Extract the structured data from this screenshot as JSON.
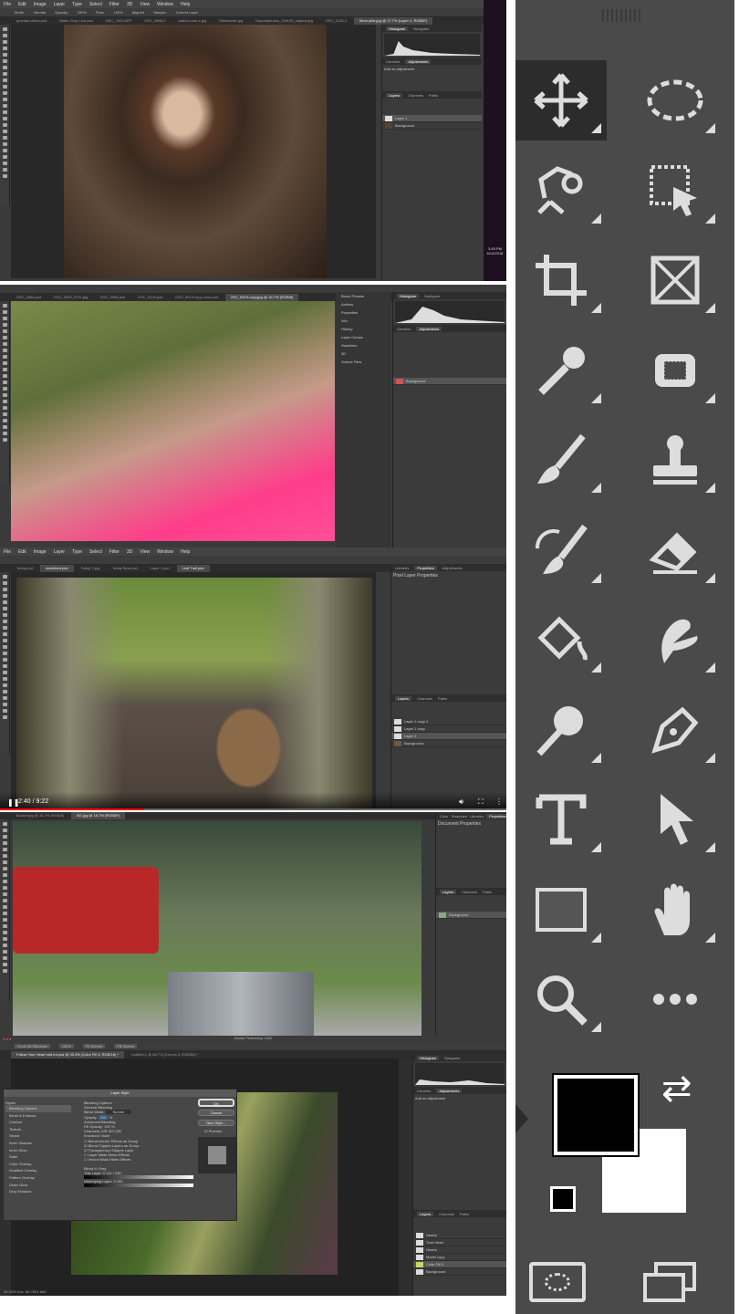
{
  "shot1": {
    "menu": [
      "File",
      "Edit",
      "Image",
      "Layer",
      "Type",
      "Select",
      "Filter",
      "3D",
      "View",
      "Window",
      "Help"
    ],
    "options": [
      "Mode:",
      "Normal",
      "Opacity:",
      "100%",
      "Flow:",
      "100%",
      "Aligned",
      "Sample:",
      "Current Layer"
    ],
    "tabs": [
      "gravitas cloths.psd",
      "Water Drop Line.psd",
      "DSC_7521.NEF",
      "DSC_0866-2",
      "sales-t-card-s.jpg",
      "Whitewash.jpg",
      "Depositphotos_106199_original.jpg",
      "DSC_0128-2",
      "Mom pilot.jpg @ 17.7% (Layer 1, RGB/8*)"
    ],
    "panel_tabs": [
      "Histogram",
      "Navigator"
    ],
    "adj_tabs": [
      "Libraries",
      "Adjustments"
    ],
    "add_adjustment": "Add an adjustment",
    "layers_tabs": [
      "Layers",
      "Channels",
      "Paths"
    ],
    "layers": [
      "Layer 1",
      "Background"
    ],
    "taskbar_time": "3:45 PM",
    "taskbar_date": "6/13/2018"
  },
  "shot2": {
    "tabs": [
      "DSC_0065.psd",
      "DSC_0000_FOG.jpg",
      "DSC_0006.psd",
      "DSC_0105.psd",
      "DSC_9919 copy-color.psd",
      "ZSC_9919-copy.jpg @ 16.7% (RGB/8)"
    ],
    "side_items": [
      "Brush Presets",
      "Actions",
      "Properties",
      "Info",
      "History",
      "Layer Comps",
      "Swatches",
      "3D",
      "Source Files"
    ],
    "panel_tabs": [
      "Histogram",
      "Navigator"
    ],
    "adj_tabs": [
      "Libraries",
      "Adjustments"
    ],
    "layers": [
      "Background"
    ],
    "zoom": "16.7%"
  },
  "shot3": {
    "menu": [
      "File",
      "Edit",
      "Image",
      "Layer",
      "Type",
      "Select",
      "Filter",
      "3D",
      "View",
      "Window",
      "Help"
    ],
    "tabs": [
      "Teddy.psd",
      "woodland.psd",
      "Teddy 2.jpg",
      "Teddy Bear.psd",
      "Layer 1.psd",
      "Leaf Trail.psd"
    ],
    "props_title": "Pixel Layer Properties",
    "panel_tabs": [
      "Libraries",
      "Properties",
      "Adjustments"
    ],
    "layers_tabs": [
      "Layers",
      "Channels",
      "Paths"
    ],
    "layers": [
      "Layer 1 copy 2",
      "Layer 1 copy",
      "Layer 1",
      "Background"
    ],
    "video": {
      "time": "2:40 / 9:22",
      "progress": 0.285
    }
  },
  "shot4": {
    "tabs": [
      "Bucket.jpg @ 16.7% (RGB/8)",
      "BG.jpg @ 16.7% (RGB/8*)"
    ],
    "panel_tabs": [
      "Color",
      "Swatches",
      "Libraries",
      "Properties"
    ],
    "props_title": "Document Properties",
    "layers_tabs": [
      "Layers",
      "Channels",
      "Paths"
    ],
    "layers": [
      "Background"
    ]
  },
  "shot5": {
    "app_title": "Adobe Photoshop 2022",
    "options": [
      "Scroll All Windows",
      "100%",
      "Fit Screen",
      "Fill Screen"
    ],
    "tabs": [
      "Follow Your Heart mid tut.psd @ 33.3% (Color Fill 3, RGB/16) *",
      "Untitled-1 @ 66.7% (Curves 3, RGB/8#) *"
    ],
    "panel_tabs": [
      "Histogram",
      "Navigator"
    ],
    "adj_tabs": [
      "Libraries",
      "Adjustments"
    ],
    "add_adjustment": "Add an adjustment",
    "layers_tabs": [
      "Layers",
      "Channels",
      "Paths"
    ],
    "layers": [
      "Hearts",
      "Tree Heart",
      "Hearts",
      "Model copy",
      "Color Fill 3",
      "Background"
    ],
    "status": "33.33%  Doc: 56.7M/1.66G",
    "dialog": {
      "title": "Layer Style",
      "styles_header": "Styles",
      "styles": [
        "Blending Options",
        "Bevel & Emboss",
        "Contour",
        "Texture",
        "Stroke",
        "Inner Shadow",
        "Inner Glow",
        "Satin",
        "Color Overlay",
        "Gradient Overlay",
        "Pattern Overlay",
        "Outer Glow",
        "Drop Shadow"
      ],
      "section": "Blending Options",
      "general": "General Blending",
      "blend_mode_label": "Blend Mode:",
      "blend_mode": "Screen",
      "opacity_label": "Opacity:",
      "opacity": "100",
      "advanced": "Advanced Blending",
      "fill_label": "Fill Opacity:",
      "fill": "100",
      "channels_label": "Channels:",
      "channels": [
        "R",
        "G",
        "B"
      ],
      "knockout_label": "Knockout:",
      "knockout": "None",
      "checks": [
        "Blend Interior Effects as Group",
        "Blend Clipped Layers as Group",
        "Transparency Shapes Layer",
        "Layer Mask Hides Effects",
        "Vector Mask Hides Effects"
      ],
      "blend_if_label": "Blend If:",
      "blend_if": "Gray",
      "this_layer": "This Layer:",
      "this_vals": "0    112 / 255",
      "underlying": "Underlying Layer:",
      "under_vals": "0    255",
      "ok": "OK",
      "cancel": "Cancel",
      "new_style": "New Style...",
      "preview": "Preview"
    }
  },
  "tools": [
    "move-tool",
    "elliptical-marquee-tool",
    "lasso-tool",
    "object-selection-tool",
    "crop-tool",
    "frame-tool",
    "eyedropper-tool",
    "spot-healing-tool",
    "brush-tool",
    "clone-stamp-tool",
    "history-brush-tool",
    "eraser-tool",
    "paint-bucket-tool",
    "smudge-tool",
    "dodge-tool",
    "pen-tool",
    "type-tool",
    "path-selection-tool",
    "rectangle-tool",
    "hand-tool",
    "zoom-tool",
    "more-tools"
  ],
  "colors": {
    "foreground": "#000000",
    "background": "#ffffff",
    "panel": "#4a4a4a"
  }
}
